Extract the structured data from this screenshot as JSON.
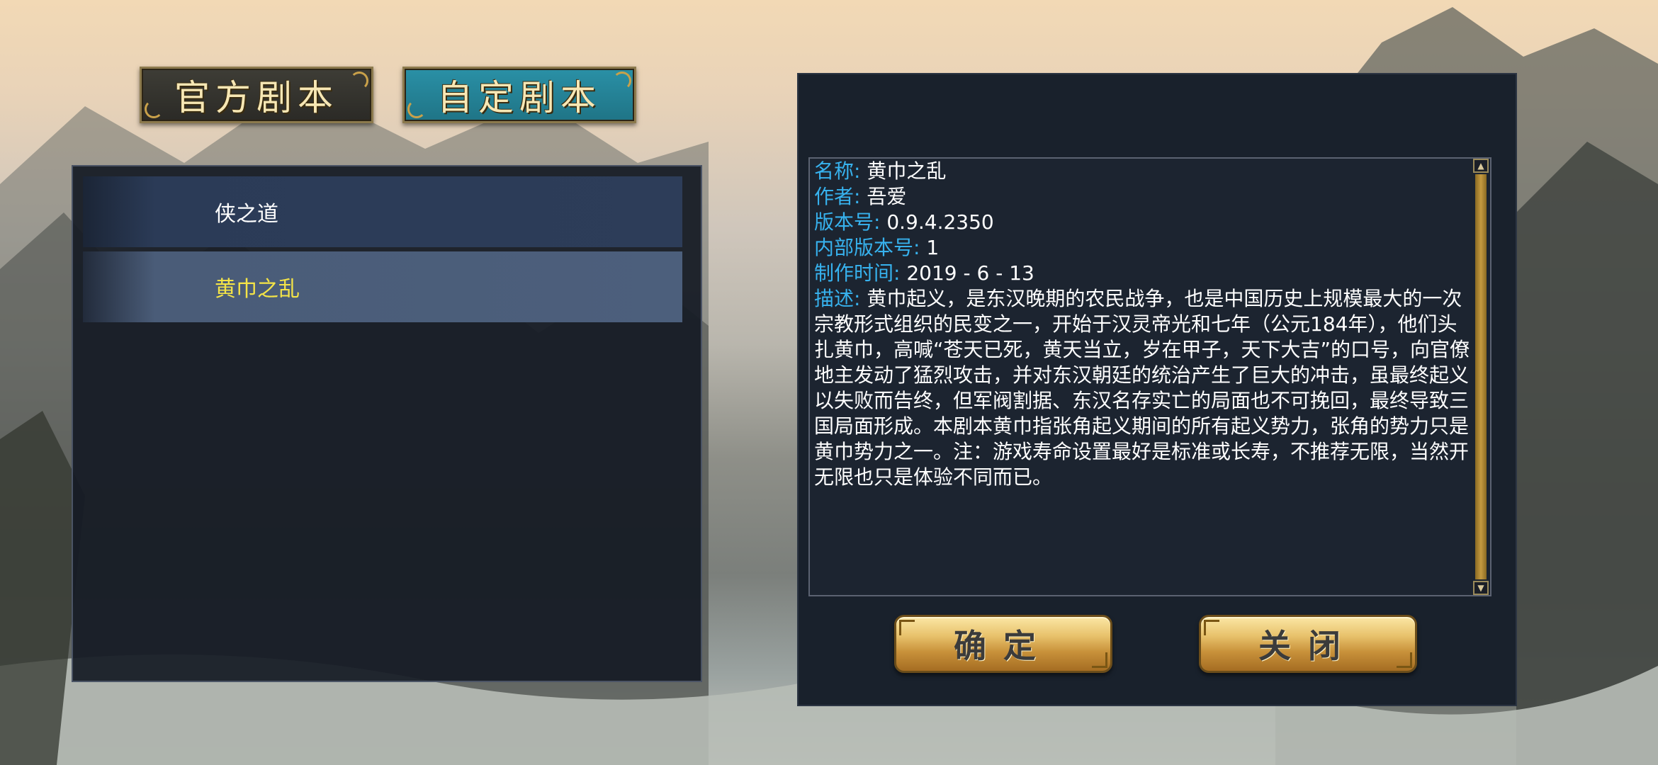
{
  "tabs": {
    "official_label": "官方剧本",
    "custom_label": "自定剧本"
  },
  "scenario_list": [
    {
      "name": "侠之道",
      "selected": false
    },
    {
      "name": "黄巾之乱",
      "selected": true
    }
  ],
  "details": {
    "name_label": "名称:",
    "name_value": "黄巾之乱",
    "author_label": "作者:",
    "author_value": "吾爱",
    "version_label": "版本号:",
    "version_value": "0.9.4.2350",
    "internal_version_label": "内部版本号:",
    "internal_version_value": "1",
    "created_label": "制作时间:",
    "created_value": "2019 - 6 - 13",
    "description_label": "描述:",
    "description_value": "黄巾起义，是东汉晚期的农民战争，也是中国历史上规模最大的一次宗教形式组织的民变之一，开始于汉灵帝光和七年（公元184年），他们头扎黄巾，高喊“苍天已死，黄天当立，岁在甲子，天下大吉”的口号，向官僚地主发动了猛烈攻击，并对东汉朝廷的统治产生了巨大的冲击，虽最终起义以失败而告终，但军阀割据、东汉名存实亡的局面也不可挽回，最终导致三国局面形成。本剧本黄巾指张角起义期间的所有起义势力，张角的势力只是黄巾势力之一。注：游戏寿命设置最好是标准或长寿，不推荐无限，当然开无限也只是体验不同而已。"
  },
  "buttons": {
    "confirm_label": "确定",
    "close_label": "关闭"
  },
  "colors": {
    "label_blue": "#37b2ee",
    "selected_yellow": "#f4e447",
    "custom_tab_teal": "#2a90a6",
    "button_gold": "#e8c26c"
  }
}
